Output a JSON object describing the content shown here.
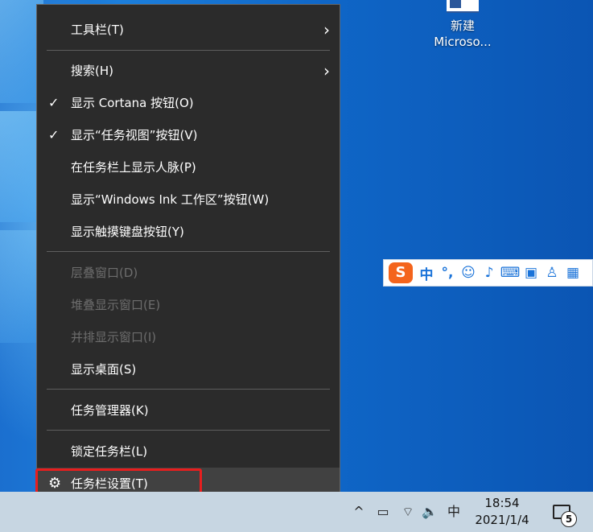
{
  "desktop": {
    "icon_label_line1": "新建",
    "icon_label_line2": "Microso..."
  },
  "ime_toolbar": {
    "logo": "S",
    "items": [
      "中",
      "°,",
      "☺",
      "🎤",
      "⌨",
      "👔",
      "👕",
      "▦"
    ]
  },
  "context_menu": {
    "items": {
      "toolbars": "工具栏(T)",
      "search": "搜索(H)",
      "show_cortana": "显示 Cortana 按钮(O)",
      "show_task_view": "显示“任务视图”按钮(V)",
      "show_people": "在任务栏上显示人脉(P)",
      "show_ink": "显示“Windows Ink 工作区”按钮(W)",
      "show_touch_keyboard": "显示触摸键盘按钮(Y)",
      "cascade": "层叠窗口(D)",
      "stacked": "堆叠显示窗口(E)",
      "side_by_side": "并排显示窗口(I)",
      "show_desktop": "显示桌面(S)",
      "task_manager": "任务管理器(K)",
      "lock_taskbar": "锁定任务栏(L)",
      "taskbar_settings": "任务栏设置(T)"
    },
    "checked": [
      "show_cortana",
      "show_task_view"
    ],
    "disabled": [
      "cascade",
      "stacked",
      "side_by_side"
    ],
    "highlighted": "taskbar_settings",
    "highlight_color": "#e81e1e"
  },
  "taskbar": {
    "tray": {
      "chevron": "^",
      "input_method": "中"
    },
    "clock": {
      "time": "18:54",
      "date": "2021/1/4"
    },
    "notification_count": "5"
  }
}
